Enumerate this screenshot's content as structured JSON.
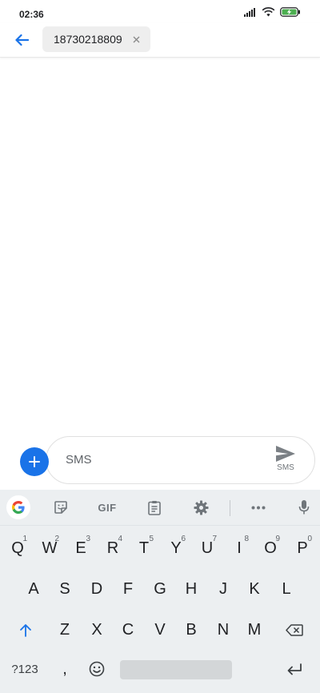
{
  "status_bar": {
    "time": "02:36",
    "battery_color": "#4caf50"
  },
  "app_bar": {
    "back_icon": "arrow-left-icon",
    "recipient": "18730218809",
    "clear_icon": "close-icon"
  },
  "compose": {
    "placeholder": "SMS",
    "send_label": "SMS",
    "accent": "#1a73e8"
  },
  "keyboard": {
    "toolbar": {
      "gif_label": "GIF"
    },
    "row1": [
      {
        "key": "Q",
        "hint": "1"
      },
      {
        "key": "W",
        "hint": "2"
      },
      {
        "key": "E",
        "hint": "3"
      },
      {
        "key": "R",
        "hint": "4"
      },
      {
        "key": "T",
        "hint": "5"
      },
      {
        "key": "Y",
        "hint": "6"
      },
      {
        "key": "U",
        "hint": "7"
      },
      {
        "key": "I",
        "hint": "8"
      },
      {
        "key": "O",
        "hint": "9"
      },
      {
        "key": "P",
        "hint": "0"
      }
    ],
    "row2": [
      "A",
      "S",
      "D",
      "F",
      "G",
      "H",
      "J",
      "K",
      "L"
    ],
    "row3": [
      "Z",
      "X",
      "C",
      "V",
      "B",
      "N",
      "M"
    ],
    "symbols_label": "?123",
    "comma_label": ","
  }
}
